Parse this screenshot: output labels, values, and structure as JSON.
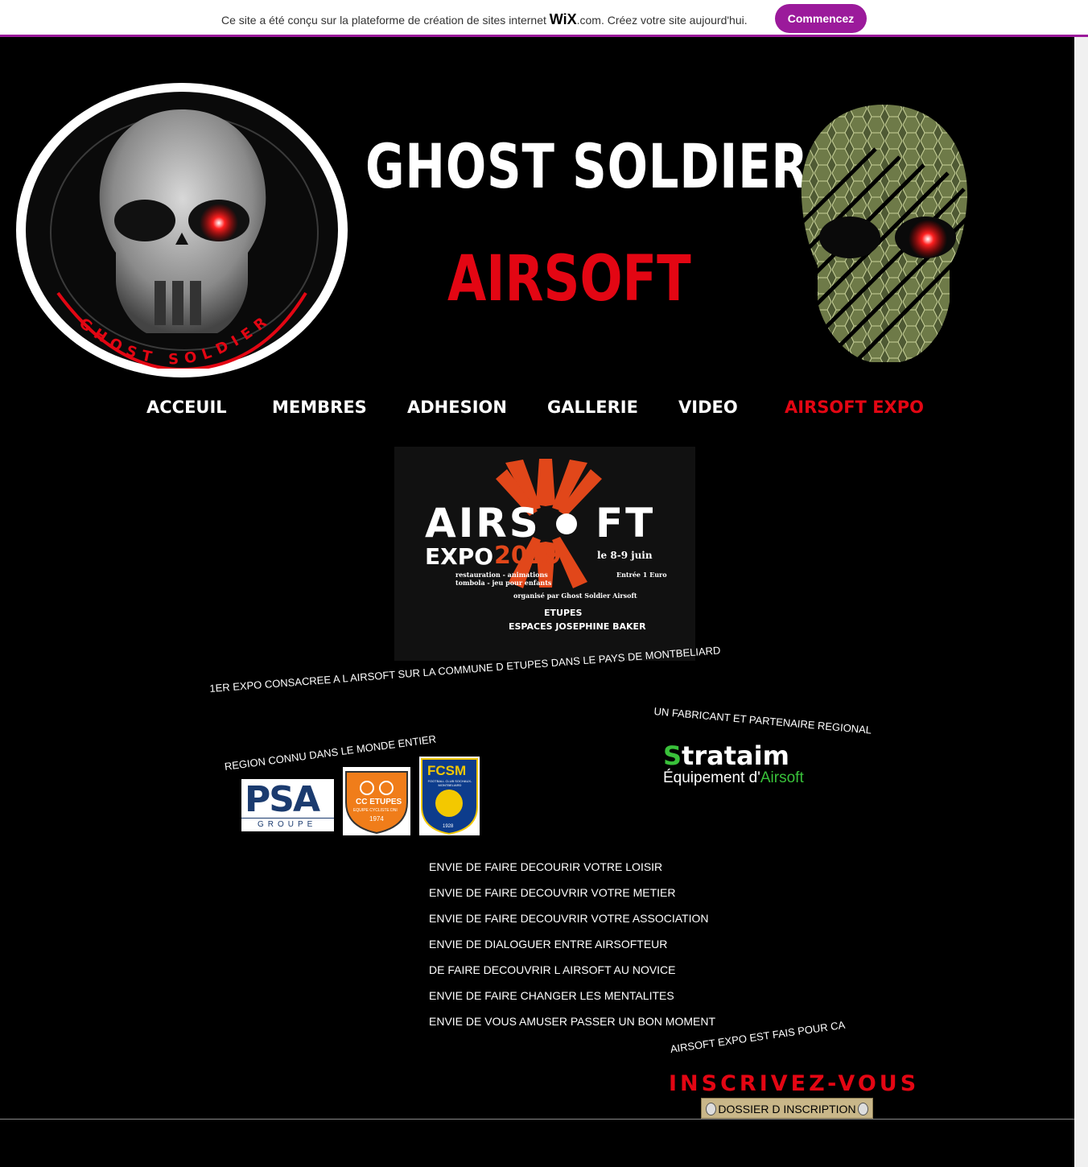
{
  "wix_banner": {
    "message_before": "Ce site a été conçu sur la plateforme de création de sites internet ",
    "brand": "WiX",
    "message_after": ".com. Créez votre site aujourd'hui.",
    "button_label": "Commencez"
  },
  "header": {
    "title_line1": "GHOST SOLDIER",
    "title_line2": "AIRSOFT",
    "logo_ring_text": "GHOST SOLDIER"
  },
  "nav": [
    {
      "label": "ACCEUIL"
    },
    {
      "label": "MEMBRES"
    },
    {
      "label": "ADHESION"
    },
    {
      "label": "GALLERIE"
    },
    {
      "label": "VIDEO"
    },
    {
      "label": "AIRSOFT EXPO"
    }
  ],
  "poster": {
    "word1": "AIRS",
    "word2": "FT",
    "expo": "EXPO",
    "year": "2019",
    "dates": "le 8-9 juin",
    "line1": "restauration - animations",
    "line2": "tombola - jeu pour enfants",
    "entry": "Entrée 1 Euro",
    "organizer": "organisé par Ghost Soldier Airsoft",
    "city": "ETUPES",
    "venue": "ESPACES JOSEPHINE BAKER"
  },
  "content": {
    "expo_caption": "1ER EXPO CONSACREE A L AIRSOFT SUR LA COMMUNE D ETUPES DANS LE PAYS DE MONTBELIARD",
    "region_caption": "REGION CONNU DANS LE MONDE ENTIER",
    "partner_caption": "UN FABRICANT ET PARTENAIRE REGIONAL",
    "partner_logo": {
      "name": "Strataim",
      "tagline_before": "Équipement d'",
      "tagline_accent": "Airsoft"
    },
    "sponsor_logos": [
      {
        "name": "PSA",
        "sub": "GROUPE"
      },
      {
        "name": "CC ETUPES",
        "sub": "EQUIPE CYCLISTE DNI",
        "year": "1974"
      },
      {
        "name": "FCSM",
        "sub": "FOOTBALL CLUB SOCHAUX-MONTBELIARD",
        "year": "1928"
      }
    ],
    "reasons": [
      "ENVIE DE FAIRE DECOURIR VOTRE LOISIR",
      "ENVIE DE FAIRE DECOUVRIR VOTRE METIER",
      "ENVIE DE FAIRE DECOUVRIR VOTRE ASSOCIATION",
      "ENVIE DE DIALOGUER ENTRE AIRSOFTEUR",
      "DE FAIRE DECOUVRIR L AIRSOFT AU NOVICE",
      "ENVIE DE FAIRE CHANGER LES MENTALITES",
      "ENVIE DE VOUS AMUSER PASSER UN BON MOMENT"
    ],
    "tagline": "AIRSOFT EXPO  EST FAIS POUR CA",
    "cta_title": "INSCRIVEZ-VOUS",
    "cta_button": "DOSSIER D INSCRIPTION"
  },
  "colors": {
    "accent_red": "#e30613",
    "wix_purple": "#9b1a9b",
    "strataim_green": "#39c13a",
    "poster_orange": "#e1471a"
  }
}
